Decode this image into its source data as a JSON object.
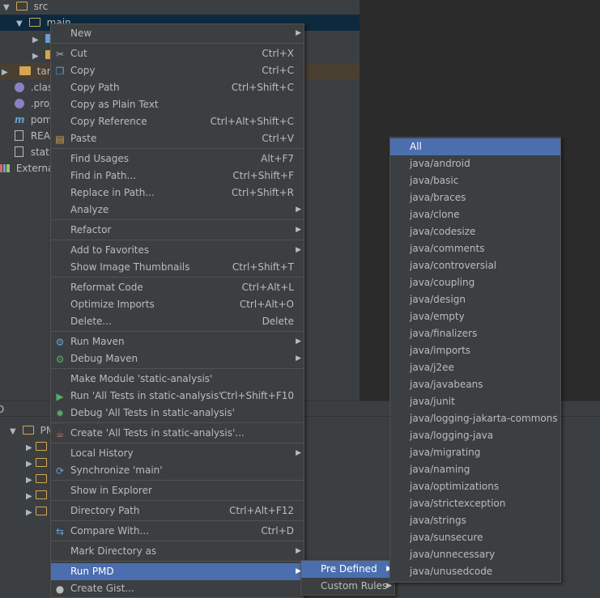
{
  "project_tree": {
    "rows": [
      {
        "label": "src"
      },
      {
        "label": "main"
      },
      {
        "label": ""
      },
      {
        "label": ""
      },
      {
        "label": "targe"
      },
      {
        "label": ".class"
      },
      {
        "label": ".proj"
      },
      {
        "label": "pom"
      },
      {
        "label": "READ"
      },
      {
        "label": "static"
      },
      {
        "label": "External"
      }
    ]
  },
  "bottom_panel": {
    "tab_label": "D",
    "root_label": "PM"
  },
  "context_menu": {
    "items": [
      {
        "label": "New",
        "shortcut": "",
        "submenu": true
      },
      {
        "label": "Cut",
        "shortcut": "Ctrl+X",
        "icon": "scissors-icon"
      },
      {
        "label": "Copy",
        "shortcut": "Ctrl+C",
        "icon": "copy-icon"
      },
      {
        "label": "Copy Path",
        "shortcut": "Ctrl+Shift+C"
      },
      {
        "label": "Copy as Plain Text",
        "shortcut": ""
      },
      {
        "label": "Copy Reference",
        "shortcut": "Ctrl+Alt+Shift+C"
      },
      {
        "label": "Paste",
        "shortcut": "Ctrl+V",
        "icon": "paste-icon"
      },
      {
        "label": "Find Usages",
        "shortcut": "Alt+F7"
      },
      {
        "label": "Find in Path...",
        "shortcut": "Ctrl+Shift+F"
      },
      {
        "label": "Replace in Path...",
        "shortcut": "Ctrl+Shift+R"
      },
      {
        "label": "Analyze",
        "shortcut": "",
        "submenu": true
      },
      {
        "label": "Refactor",
        "shortcut": "",
        "submenu": true
      },
      {
        "label": "Add to Favorites",
        "shortcut": "",
        "submenu": true
      },
      {
        "label": "Show Image Thumbnails",
        "shortcut": "Ctrl+Shift+T"
      },
      {
        "label": "Reformat Code",
        "shortcut": "Ctrl+Alt+L"
      },
      {
        "label": "Optimize Imports",
        "shortcut": "Ctrl+Alt+O"
      },
      {
        "label": "Delete...",
        "shortcut": "Delete"
      },
      {
        "label": "Run Maven",
        "shortcut": "",
        "submenu": true,
        "icon": "gear-icon"
      },
      {
        "label": "Debug Maven",
        "shortcut": "",
        "submenu": true,
        "icon": "debug-gear-icon"
      },
      {
        "label": "Make Module 'static-analysis'",
        "shortcut": ""
      },
      {
        "label": "Run 'All Tests in static-analysis'",
        "shortcut": "Ctrl+Shift+F10",
        "icon": "run-icon"
      },
      {
        "label": "Debug 'All Tests in static-analysis'",
        "shortcut": "",
        "icon": "bug-icon"
      },
      {
        "label": "Create 'All Tests in static-analysis'...",
        "shortcut": "",
        "icon": "java-icon"
      },
      {
        "label": "Local History",
        "shortcut": "",
        "submenu": true
      },
      {
        "label": "Synchronize 'main'",
        "shortcut": "",
        "icon": "sync-icon"
      },
      {
        "label": "Show in Explorer",
        "shortcut": ""
      },
      {
        "label": "Directory Path",
        "shortcut": "Ctrl+Alt+F12"
      },
      {
        "label": "Compare With...",
        "shortcut": "Ctrl+D",
        "icon": "compare-icon"
      },
      {
        "label": "Mark Directory as",
        "shortcut": "",
        "submenu": true
      },
      {
        "label": "Run PMD",
        "shortcut": "",
        "submenu": true
      },
      {
        "label": "Create Gist...",
        "shortcut": "",
        "icon": "github-icon"
      }
    ]
  },
  "pmd_submenu": {
    "items": [
      {
        "label": "Pre Defined"
      },
      {
        "label": "Custom Rules"
      }
    ]
  },
  "rules_submenu": {
    "items": [
      "All",
      "java/android",
      "java/basic",
      "java/braces",
      "java/clone",
      "java/codesize",
      "java/comments",
      "java/controversial",
      "java/coupling",
      "java/design",
      "java/empty",
      "java/finalizers",
      "java/imports",
      "java/j2ee",
      "java/javabeans",
      "java/junit",
      "java/logging-jakarta-commons",
      "java/logging-java",
      "java/migrating",
      "java/naming",
      "java/optimizations",
      "java/strictexception",
      "java/strings",
      "java/sunsecure",
      "java/unnecessary",
      "java/unusedcode"
    ]
  },
  "colors": {
    "selection": "#4b6eaf",
    "background": "#3c3f41",
    "editor": "#2b2b2b"
  }
}
